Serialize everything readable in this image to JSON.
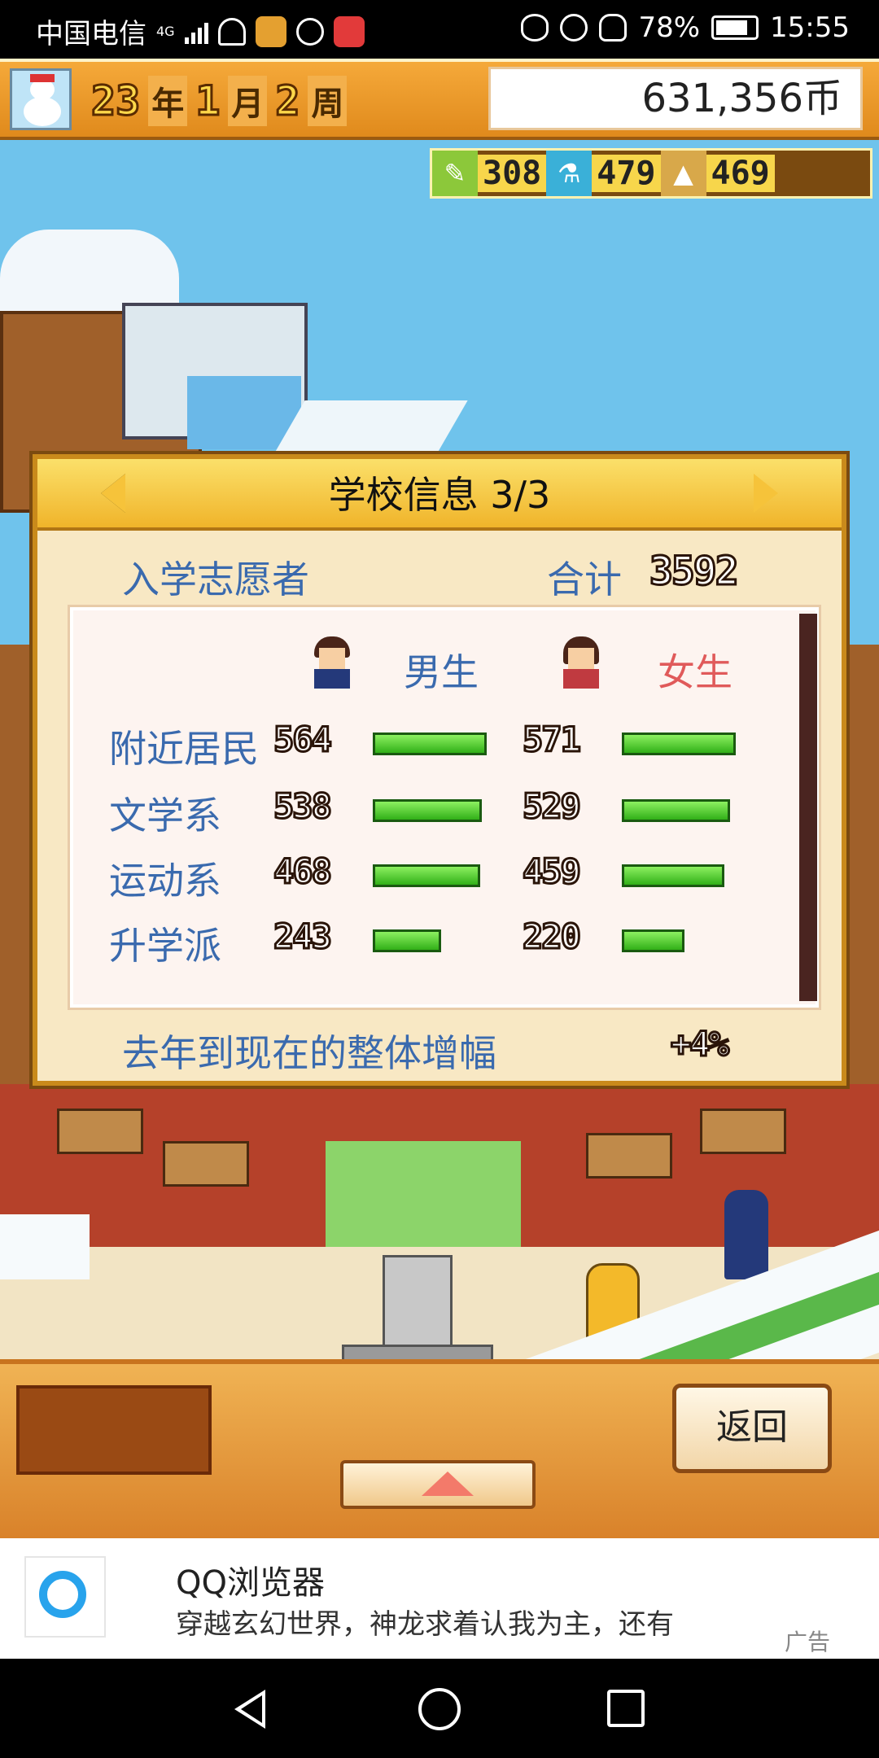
{
  "status_bar": {
    "carrier": "中国电信",
    "network": "4G",
    "battery": "78%",
    "time": "15:55"
  },
  "game_header": {
    "year_num": "23",
    "year_unit": "年",
    "month_num": "1",
    "month_unit": "月",
    "week_num": "2",
    "week_unit": "周",
    "money": "631,356币"
  },
  "resources": [
    {
      "icon": "pencil-icon",
      "value": "308"
    },
    {
      "icon": "flask-icon",
      "value": "479"
    },
    {
      "icon": "pyramid-icon",
      "value": "469"
    }
  ],
  "dialog": {
    "title": "学校信息 3/3",
    "applicants_label": "入学志愿者",
    "total_label": "合计",
    "total_value": "3592",
    "male_label": "男生",
    "female_label": "女生",
    "rows": [
      {
        "label": "附近居民",
        "male": "564",
        "female": "571",
        "male_fill": 1.0,
        "female_fill": 1.0
      },
      {
        "label": "文学系",
        "male": "538",
        "female": "529",
        "male_fill": 0.96,
        "female_fill": 0.95
      },
      {
        "label": "运动系",
        "male": "468",
        "female": "459",
        "male_fill": 0.94,
        "female_fill": 0.9
      },
      {
        "label": "升学派",
        "male": "243",
        "female": "220",
        "male_fill": 0.6,
        "female_fill": 0.55
      }
    ],
    "growth_label": "去年到现在的整体增幅",
    "growth_value": "+4%"
  },
  "bottom": {
    "return_label": "返回"
  },
  "ad": {
    "title": "QQ浏览器",
    "description": "穿越玄幻世界，神龙求着认我为主，还有",
    "tag": "广告"
  },
  "colors": {
    "accent_orange": "#e08a1c",
    "bar_green": "#32b018",
    "male_blue": "#3a6aae",
    "female_red": "#e05a5a"
  }
}
